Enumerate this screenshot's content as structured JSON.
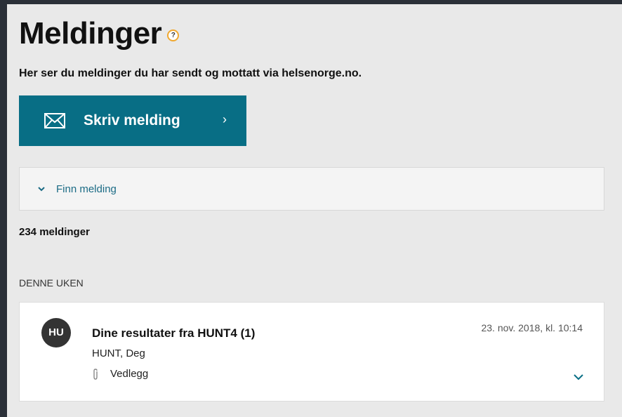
{
  "page": {
    "title": "Meldinger",
    "help_symbol": "?"
  },
  "intro_text": "Her ser du meldinger du har sendt og mottatt via helsenorge.no.",
  "write_button": {
    "label": "Skriv melding",
    "chevron": "›"
  },
  "search_panel": {
    "label": "Finn melding"
  },
  "message_count": "234 meldinger",
  "section_header": "DENNE UKEN",
  "messages": [
    {
      "avatar": "HU",
      "subject": "Dine resultater fra HUNT4 (1)",
      "sender": "HUNT, Deg",
      "date": "23. nov. 2018, kl. 10:14",
      "attachment_label": "Vedlegg"
    }
  ],
  "colors": {
    "accent": "#086e85",
    "link": "#1b6b85",
    "help_ring": "#f0a830"
  }
}
